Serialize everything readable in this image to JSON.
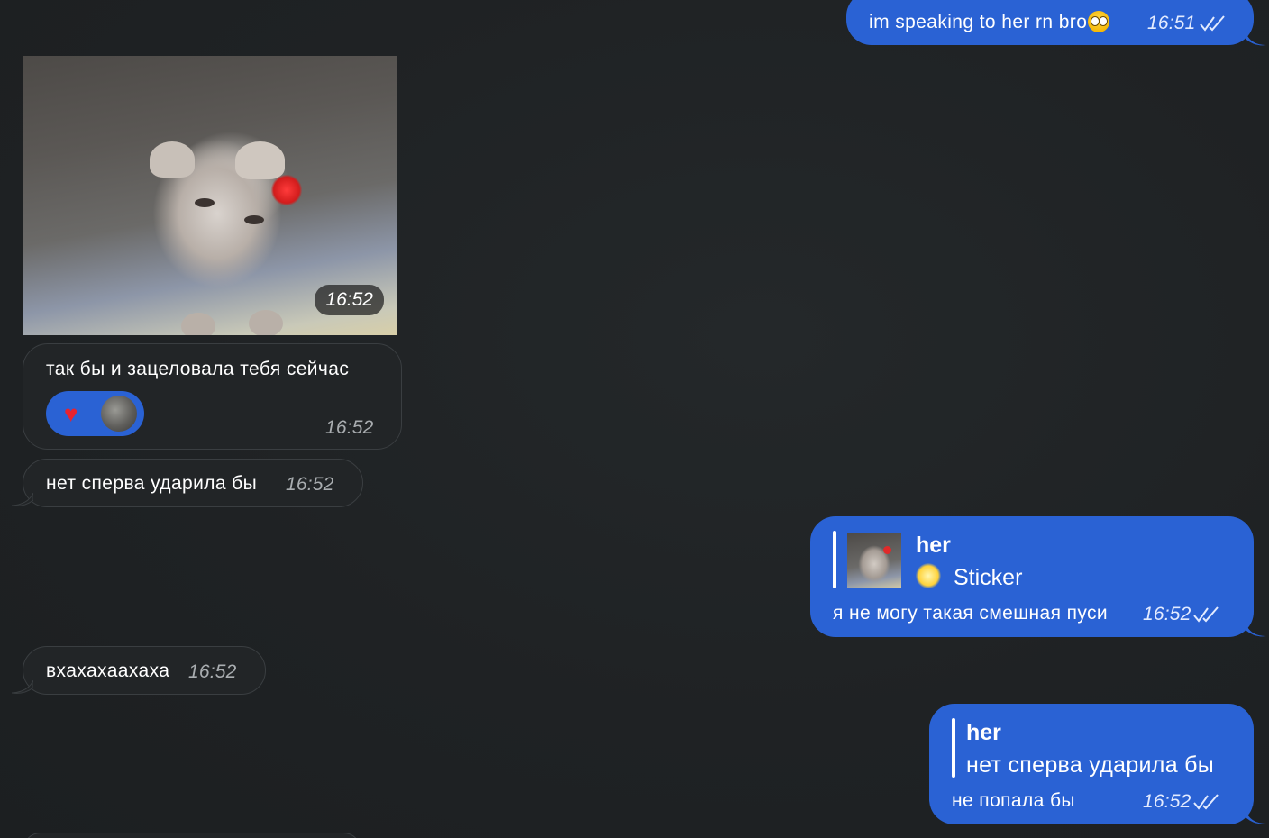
{
  "colors": {
    "outgoing_bubble": "#2a62d4",
    "incoming_bubble": "#222527",
    "background": "#1f2224"
  },
  "messages": [
    {
      "id": "m1",
      "direction": "out",
      "text": "im speaking to her rn bro",
      "emoji": "flushed-eyes-emoji",
      "time": "16:51",
      "status": "read"
    },
    {
      "id": "photo",
      "direction": "in",
      "type": "image",
      "image": "angry-kitten-photo",
      "time": "16:52"
    },
    {
      "id": "m2",
      "direction": "in",
      "text": "так бы и зацеловала тебя сейчас",
      "time": "16:52",
      "reactions": [
        "heart",
        "avatar"
      ]
    },
    {
      "id": "m3",
      "direction": "in",
      "text": "нет сперва ударила бы",
      "time": "16:52"
    },
    {
      "id": "m4",
      "direction": "out",
      "reply": {
        "name": "her",
        "preview": "Sticker",
        "preview_icon": "sparkle-star-icon"
      },
      "text": "я не могу такая смешная пуси",
      "time": "16:52",
      "status": "read"
    },
    {
      "id": "m5",
      "direction": "in",
      "text": "вхахахаахаха",
      "time": "16:52"
    },
    {
      "id": "m6",
      "direction": "out",
      "reply": {
        "name": "her",
        "preview": "нет сперва ударила бы"
      },
      "text": "не попала бы",
      "time": "16:52",
      "status": "read"
    }
  ]
}
